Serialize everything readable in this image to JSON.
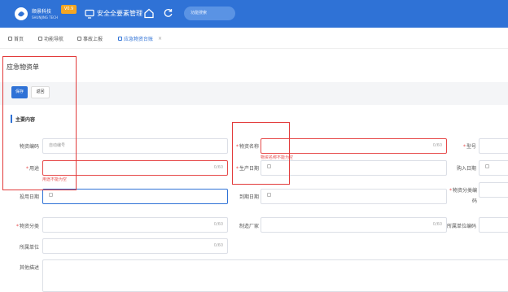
{
  "header": {
    "brand_name": "顺景科技",
    "brand_en": "SHUNJING TECH",
    "version": "V0.9",
    "system_title": "安全全要素管理",
    "search_placeholder": "功能搜索"
  },
  "tabs": [
    {
      "label": "首页",
      "active": false
    },
    {
      "label": "功能导航",
      "active": false
    },
    {
      "label": "事故上报",
      "active": false
    },
    {
      "label": "应急物资台账",
      "active": true
    }
  ],
  "tab_close": "×",
  "page": {
    "title": "应急物资单",
    "save_label": "保存",
    "back_label": "返回",
    "section_title": "主要内容"
  },
  "form": {
    "code_label": "物资编码",
    "code_placeholder": "自动编号",
    "name_label": "物资名称",
    "name_counter": "0/60",
    "name_error": "物资名称不能为空",
    "model_label": "型号",
    "purpose_label": "用途",
    "purpose_counter": "0/60",
    "purpose_error": "用途不能为空",
    "prod_date_label": "生产日期",
    "buy_date_label": "购入日期",
    "use_date_label": "投用日期",
    "expire_date_label": "到期日期",
    "category_code_label": "物资分类编码",
    "category_label": "物资分类",
    "category_counter": "0/60",
    "maker_label": "制造厂家",
    "maker_counter": "0/60",
    "unit_code_label": "所属单位编码",
    "unit_label": "所属单位",
    "unit_counter": "0/60",
    "desc_label": "其他描述"
  },
  "colors": {
    "primary": "#2f72d6",
    "error": "#e64a4a",
    "version_badge": "#f5a623"
  }
}
